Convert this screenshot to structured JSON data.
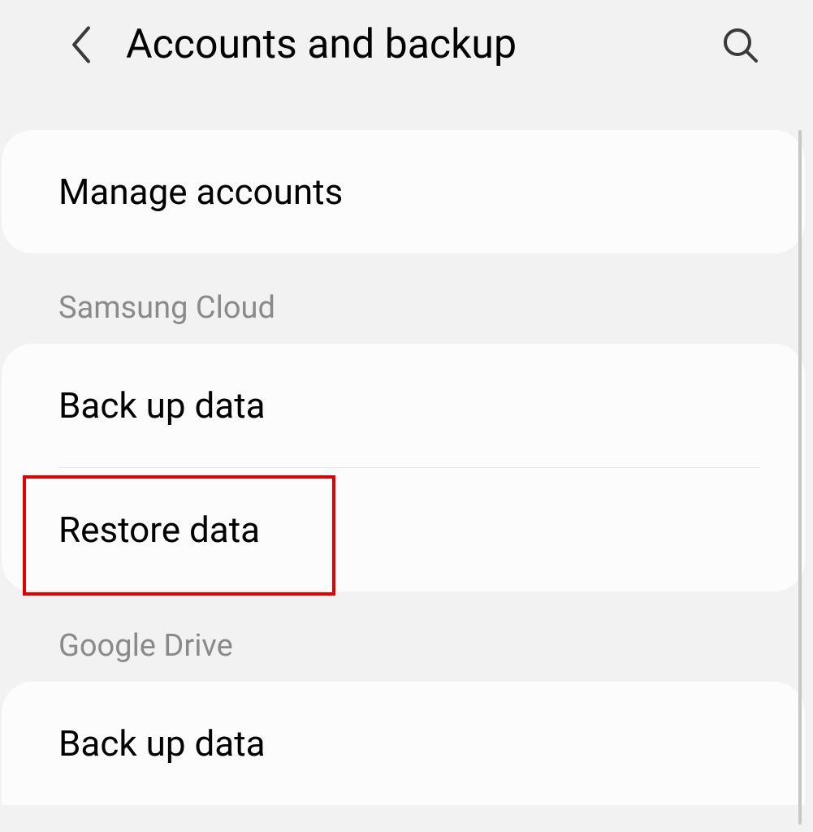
{
  "header": {
    "title": "Accounts and backup"
  },
  "sections": {
    "top": {
      "manage_accounts": "Manage accounts"
    },
    "samsung_cloud": {
      "header": "Samsung Cloud",
      "backup": "Back up data",
      "restore": "Restore data"
    },
    "google_drive": {
      "header": "Google Drive",
      "backup": "Back up data"
    }
  },
  "highlight": {
    "target": "restore-data-item"
  }
}
